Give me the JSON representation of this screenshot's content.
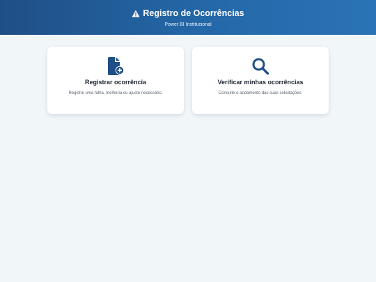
{
  "header": {
    "title": "Registro de Ocorrências",
    "subtitle": "Power BI Institucional",
    "icon": "warning-icon"
  },
  "cards": [
    {
      "title": "Registrar ocorrência",
      "description": "Registre uma falha, melhoria ou ajuste necessário.",
      "icon": "file-add-icon"
    },
    {
      "title": "Verificar minhas ocorrências",
      "description": "Consulte o andamento das suas solicitações.",
      "icon": "search-icon"
    }
  ],
  "colors": {
    "header_start": "#1f4f86",
    "header_end": "#2a73b6",
    "icon": "#1f4f86",
    "background": "#f1f6f9"
  }
}
